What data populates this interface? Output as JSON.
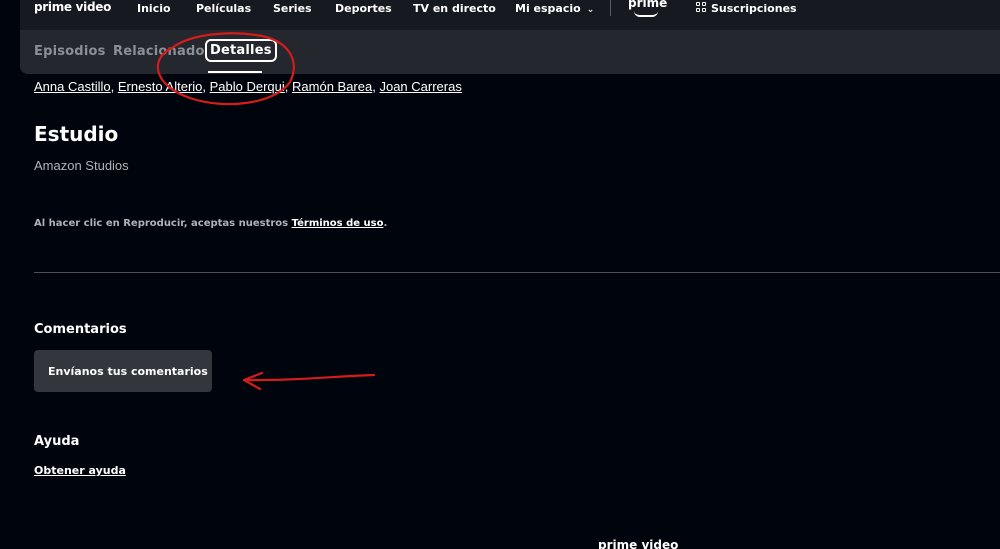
{
  "header": {
    "brand": "prime video",
    "nav": [
      "Inicio",
      "Películas",
      "Series",
      "Deportes",
      "TV en directo",
      "Mi espacio"
    ],
    "prime_logo": "prime",
    "subscriptions": "Suscripciones"
  },
  "tabs": [
    "Episodios",
    "Relacionado",
    "Detalles"
  ],
  "active_tab": "Detalles",
  "cast": [
    "Anna Castillo",
    "Ernesto Alterio",
    "Pablo Derqui",
    "Ramón Barea",
    "Joan Carreras"
  ],
  "studio": {
    "heading": "Estudio",
    "name": "Amazon Studios"
  },
  "terms": {
    "prefix": "Al hacer clic en Reproducir, aceptas nuestros ",
    "link": "Términos de uso",
    "suffix": "."
  },
  "feedback": {
    "heading": "Comentarios",
    "button": "Envíanos tus comentarios"
  },
  "help": {
    "heading": "Ayuda",
    "link": "Obtener ayuda"
  },
  "footer": {
    "brand": "prime video"
  },
  "colors": {
    "background": "#00050d",
    "nav_background": "#16191f",
    "tab_band": "#24272e",
    "button": "#33373d",
    "annotation": "#d41c1c"
  },
  "icons": {
    "dropdown": "chevron-down-icon",
    "subscriptions": "grid-icon",
    "prime_smile": "smile-icon"
  }
}
